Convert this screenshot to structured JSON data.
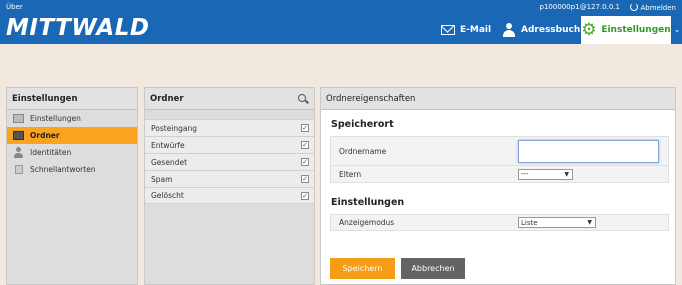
{
  "topbar": {
    "about": "Über",
    "user": "p100000p1@127.0.0.1",
    "logout": "Abmelden",
    "logo": "MITTWALD",
    "nav": {
      "email": "E-Mail",
      "address_book": "Adressbuch",
      "settings": "Einstellungen"
    }
  },
  "settings_panel": {
    "title": "Einstellungen",
    "items": [
      {
        "label": "Einstellungen",
        "icon": "monitor-icon"
      },
      {
        "label": "Ordner",
        "icon": "folder-icon",
        "active": true
      },
      {
        "label": "Identitäten",
        "icon": "person-icon"
      },
      {
        "label": "Schnellantworten",
        "icon": "document-icon"
      }
    ]
  },
  "folders_panel": {
    "title": "Ordner",
    "items": [
      {
        "label": "Posteingang",
        "checked": true
      },
      {
        "label": "Entwürfe",
        "checked": true
      },
      {
        "label": "Gesendet",
        "checked": true
      },
      {
        "label": "Spam",
        "checked": true
      },
      {
        "label": "Gelöscht",
        "checked": true
      }
    ]
  },
  "properties_panel": {
    "title": "Ordnereigenschaften",
    "location_section": "Speicherort",
    "folder_name_label": "Ordnername",
    "folder_name_value": "",
    "parent_label": "Eltern",
    "parent_value": "---",
    "settings_section": "Einstellungen",
    "view_mode_label": "Anzeigemodus",
    "view_mode_value": "Liste",
    "save_label": "Speichern",
    "cancel_label": "Abbrechen"
  },
  "colors": {
    "header": "#1a68b5",
    "accent": "#f9a320",
    "active_nav": "#2e9a20"
  }
}
